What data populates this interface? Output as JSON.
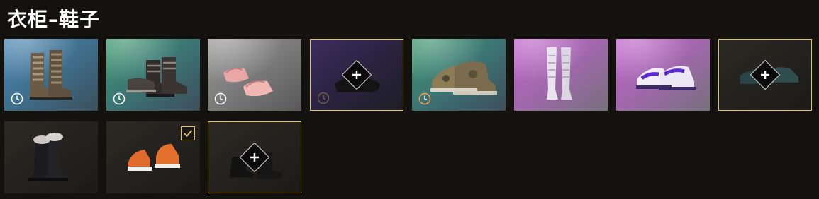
{
  "header": {
    "title": "衣柜–鞋子"
  },
  "colors": {
    "accent": "#e3c458",
    "background": "#14120f"
  },
  "items": [
    {
      "name": "brown-wrapped-boots",
      "background": "blue",
      "timer_icon": "clock-icon",
      "state": "timed"
    },
    {
      "name": "black-buckle-boots",
      "background": "green",
      "timer_icon": "clock-icon",
      "state": "timed"
    },
    {
      "name": "pink-slides",
      "background": "gray",
      "timer_icon": "clock-icon",
      "state": "timed"
    },
    {
      "name": "dark-shoe-slot",
      "background": "purple",
      "action_icon": "plus-icon",
      "state": "empty-slot"
    },
    {
      "name": "camo-sneakers",
      "background": "green",
      "timer_icon": "clock-icon",
      "state": "timed"
    },
    {
      "name": "white-tall-boots",
      "background": "pink",
      "state": "owned"
    },
    {
      "name": "purple-white-sneakers",
      "background": "pink",
      "state": "owned"
    },
    {
      "name": "teal-shoe-slot",
      "background": "dark",
      "action_icon": "plus-icon",
      "state": "empty-slot"
    },
    {
      "name": "fur-lined-black-boots",
      "background": "dark",
      "state": "owned"
    },
    {
      "name": "orange-hiking-boots",
      "background": "dark",
      "selected_icon": "check-icon",
      "state": "equipped"
    },
    {
      "name": "black-boot-slot",
      "background": "dark",
      "action_icon": "plus-icon",
      "state": "empty-slot"
    }
  ]
}
